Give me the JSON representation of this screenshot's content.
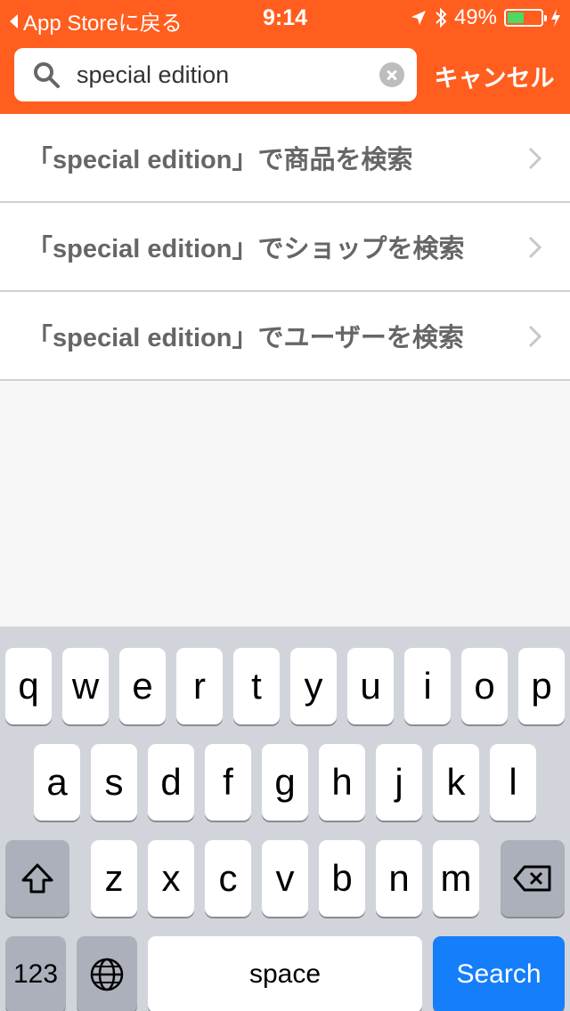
{
  "status": {
    "back_label": "App Storeに戻る",
    "time": "9:14",
    "battery": "49%",
    "battery_level": 0.49
  },
  "search": {
    "value": "special edition",
    "cancel_label": "キャンセル"
  },
  "results": [
    {
      "label": "「special edition」で商品を検索"
    },
    {
      "label": "「special edition」でショップを検索"
    },
    {
      "label": "「special edition」でユーザーを検索"
    }
  ],
  "keyboard": {
    "row1": [
      "q",
      "w",
      "e",
      "r",
      "t",
      "y",
      "u",
      "i",
      "o",
      "p"
    ],
    "row2": [
      "a",
      "s",
      "d",
      "f",
      "g",
      "h",
      "j",
      "k",
      "l"
    ],
    "row3": [
      "z",
      "x",
      "c",
      "v",
      "b",
      "n",
      "m"
    ],
    "numbers_label": "123",
    "space_label": "space",
    "search_label": "Search"
  },
  "colors": {
    "brand": "#ff5e1f",
    "search_key": "#147efb",
    "battery": "#4cd964"
  }
}
